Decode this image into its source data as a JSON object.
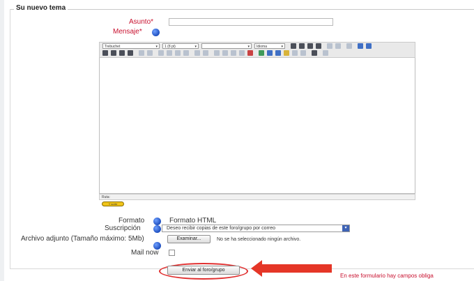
{
  "form": {
    "legend": "Su nuevo tema",
    "subject_label": "Asunto",
    "message_label": "Mensaje",
    "required_marker": "*",
    "subject_value": ""
  },
  "editor": {
    "font_select": "Trebuchet",
    "size_select": "1 (8 pt)",
    "format_select": "",
    "language_select": "Idioma",
    "path_label": "Ruta:",
    "resize_label": "Y sorte"
  },
  "fields": {
    "format_label": "Formato",
    "format_value": "Formato HTML",
    "subscription_label": "Suscripción",
    "subscription_value": "Deseo recibir copias de este foro/grupo por correo",
    "attachment_label": "Archivo adjunto (Tamaño máximo: 5Mb)",
    "browse_button": "Examinar...",
    "no_file_text": "No se ha seleccionado ningún archivo.",
    "mail_now_label": "Mail now"
  },
  "actions": {
    "submit_button": "Enviar al foro/grupo",
    "required_note": "En este formulario hay campos obliga"
  },
  "colors": {
    "required_red": "#c8102e",
    "annotation_red": "#e53627",
    "help_blue": "#1f4fbf"
  },
  "icons": [
    "help-icon",
    "dropdown-arrow-icon",
    "annotation-arrow-icon"
  ]
}
